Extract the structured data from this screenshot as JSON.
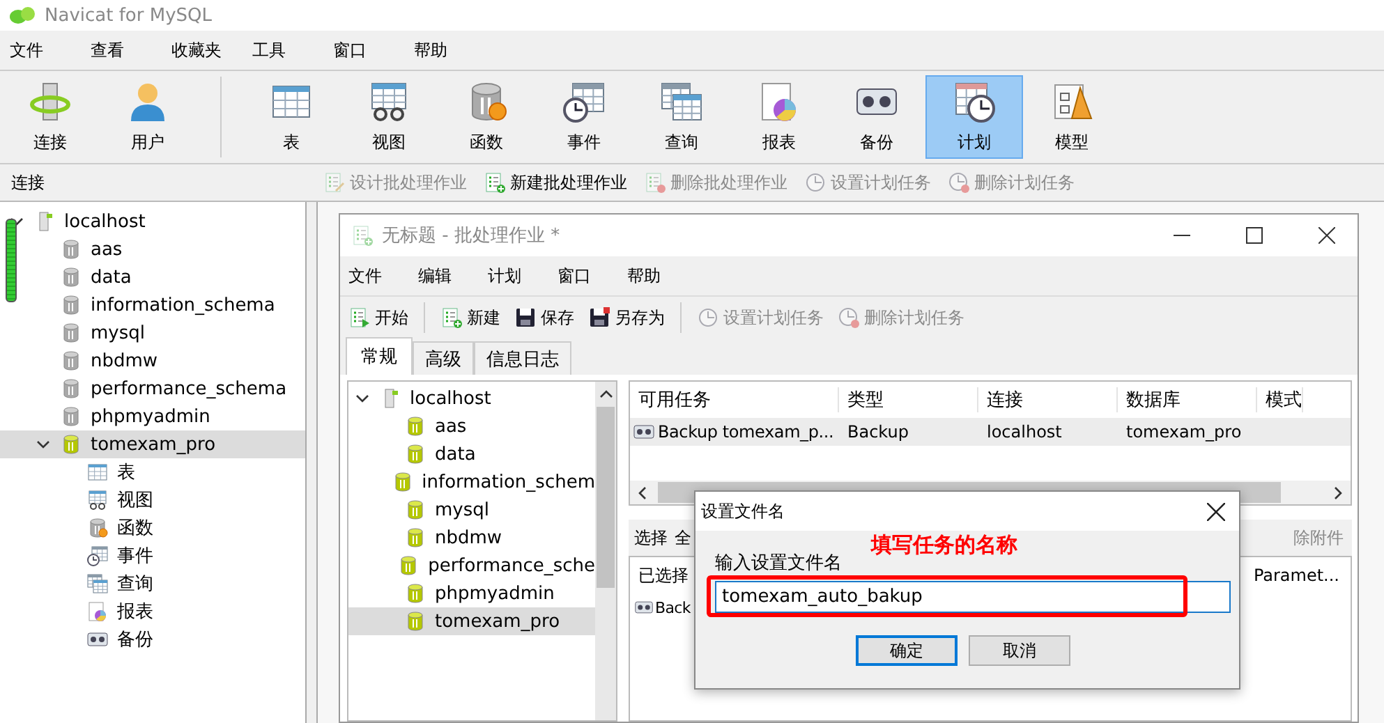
{
  "window": {
    "title": "Navicat for MySQL"
  },
  "menu": [
    "文件",
    "查看",
    "收藏夹",
    "工具",
    "窗口",
    "帮助"
  ],
  "toolbar": {
    "left": [
      {
        "label": "连接",
        "kind": "connect",
        "selected": false
      },
      {
        "label": "用户",
        "kind": "user",
        "selected": false
      }
    ],
    "main": [
      {
        "label": "表",
        "kind": "table",
        "selected": false
      },
      {
        "label": "视图",
        "kind": "view",
        "selected": false
      },
      {
        "label": "函数",
        "kind": "function",
        "selected": false
      },
      {
        "label": "事件",
        "kind": "event",
        "selected": false
      },
      {
        "label": "查询",
        "kind": "query",
        "selected": false
      },
      {
        "label": "报表",
        "kind": "report",
        "selected": false
      },
      {
        "label": "备份",
        "kind": "backup",
        "selected": false
      },
      {
        "label": "计划",
        "kind": "schedule",
        "selected": true
      },
      {
        "label": "模型",
        "kind": "model",
        "selected": false
      }
    ]
  },
  "subbar": {
    "label": "连接",
    "actions": [
      {
        "label": "设计批处理作业",
        "kind": "design",
        "disabled": true
      },
      {
        "label": "新建批处理作业",
        "kind": "new",
        "disabled": false
      },
      {
        "label": "删除批处理作业",
        "kind": "delete",
        "disabled": true
      },
      {
        "label": "设置计划任务",
        "kind": "clock",
        "disabled": true
      },
      {
        "label": "删除计划任务",
        "kind": "clock-delete",
        "disabled": true
      }
    ]
  },
  "sidebar": {
    "tree": [
      {
        "label": "localhost",
        "kind": "server",
        "selected": false,
        "children": [
          {
            "label": "aas",
            "kind": "db",
            "selected": false
          },
          {
            "label": "data",
            "kind": "db",
            "selected": false
          },
          {
            "label": "information_schema",
            "kind": "db",
            "selected": false
          },
          {
            "label": "mysql",
            "kind": "db",
            "selected": false
          },
          {
            "label": "nbdmw",
            "kind": "db",
            "selected": false
          },
          {
            "label": "performance_schema",
            "kind": "db",
            "selected": false
          },
          {
            "label": "phpmyadmin",
            "kind": "db",
            "selected": false
          },
          {
            "label": "tomexam_pro",
            "kind": "db-open",
            "selected": true,
            "children": [
              {
                "label": "表",
                "kind": "table",
                "selected": false
              },
              {
                "label": "视图",
                "kind": "view",
                "selected": false
              },
              {
                "label": "函数",
                "kind": "function",
                "selected": false
              },
              {
                "label": "事件",
                "kind": "event",
                "selected": false
              },
              {
                "label": "查询",
                "kind": "query",
                "selected": false
              },
              {
                "label": "报表",
                "kind": "report",
                "selected": false
              },
              {
                "label": "备份",
                "kind": "backup",
                "selected": false
              }
            ]
          }
        ]
      }
    ]
  },
  "batch_window": {
    "title": "无标题 - 批处理作业 *",
    "menu": [
      "文件",
      "编辑",
      "计划",
      "窗口",
      "帮助"
    ],
    "toolbar": [
      [
        {
          "label": "开始",
          "kind": "start",
          "disabled": false
        }
      ],
      [
        {
          "label": "新建",
          "kind": "new",
          "disabled": false
        },
        {
          "label": "保存",
          "kind": "save",
          "disabled": false
        },
        {
          "label": "另存为",
          "kind": "saveas",
          "disabled": false
        }
      ],
      [
        {
          "label": "设置计划任务",
          "kind": "clock",
          "disabled": true
        },
        {
          "label": "删除计划任务",
          "kind": "clock-delete",
          "disabled": true
        }
      ]
    ],
    "tabs": [
      {
        "label": "常规",
        "selected": true
      },
      {
        "label": "高级",
        "selected": false
      },
      {
        "label": "信息日志",
        "selected": false
      }
    ],
    "tree": [
      {
        "label": "localhost",
        "kind": "server",
        "selected": false,
        "children": [
          {
            "label": "aas",
            "kind": "db-open",
            "selected": false
          },
          {
            "label": "data",
            "kind": "db-open",
            "selected": false
          },
          {
            "label": "information_schem",
            "kind": "db-open",
            "selected": false
          },
          {
            "label": "mysql",
            "kind": "db-open",
            "selected": false
          },
          {
            "label": "nbdmw",
            "kind": "db-open",
            "selected": false
          },
          {
            "label": "performance_sche",
            "kind": "db-open",
            "selected": false
          },
          {
            "label": "phpmyadmin",
            "kind": "db-open",
            "selected": false
          },
          {
            "label": "tomexam_pro",
            "kind": "db-open",
            "selected": true
          }
        ]
      }
    ],
    "tasks": {
      "columns": [
        "可用任务",
        "类型",
        "连接",
        "数据库",
        "模式"
      ],
      "rows": [
        {
          "cells": [
            "Backup tomexam_p...",
            "Backup",
            "localhost",
            "tomexam_pro"
          ],
          "selected": true
        }
      ]
    },
    "selection_bar": {
      "items": [
        "选择",
        "全"
      ],
      "right": "除附件"
    },
    "selected_list": {
      "columns": [
        "已选择",
        "Paramet..."
      ],
      "rows": [
        "Back"
      ]
    }
  },
  "dialog": {
    "title": "设置文件名",
    "label": "输入设置文件名",
    "value": "tomexam_auto_bakup",
    "buttons": [
      {
        "label": "确定",
        "focused": true
      },
      {
        "label": "取消",
        "focused": false
      }
    ]
  },
  "annotation": {
    "text": "填写任务的名称"
  }
}
